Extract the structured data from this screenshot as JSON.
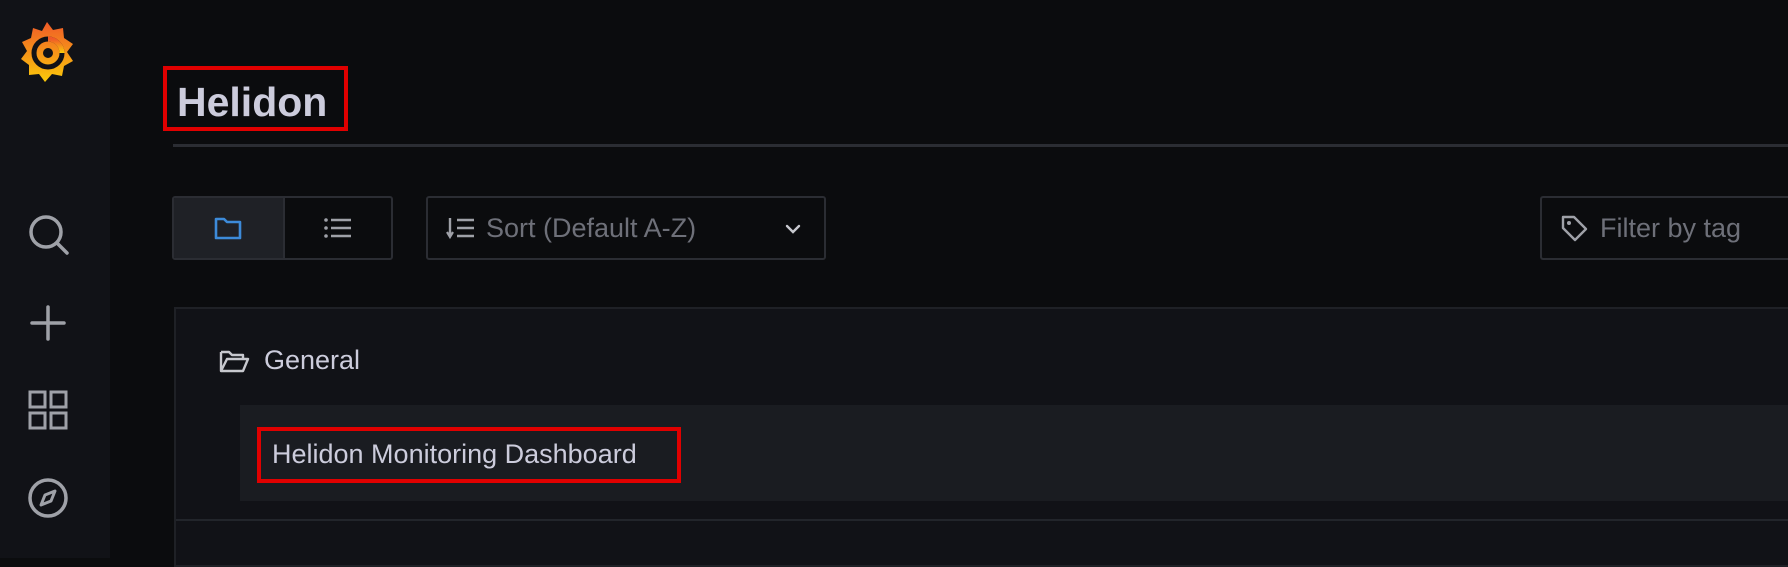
{
  "sidebar": {
    "logo_icon": "grafana-logo-icon",
    "items": [
      {
        "name": "search",
        "icon": "search-icon"
      },
      {
        "name": "create",
        "icon": "plus-icon"
      },
      {
        "name": "dashboards",
        "icon": "grid-icon"
      },
      {
        "name": "explore",
        "icon": "compass-icon"
      }
    ]
  },
  "header": {
    "title": "Helidon"
  },
  "toolbar": {
    "view_folders_icon": "folder-icon",
    "view_list_icon": "list-icon",
    "sort_label": "Sort (Default A-Z)",
    "tag_filter_placeholder": "Filter by tag"
  },
  "results": {
    "folder": {
      "label": "General",
      "icon": "folder-open-icon"
    },
    "dashboards": [
      {
        "title": "Helidon Monitoring Dashboard"
      }
    ]
  },
  "colors": {
    "highlight_border": "#e00000",
    "accent_blue": "#3d8bd9",
    "text": "#ccccdc",
    "muted_text": "#6e7079"
  }
}
